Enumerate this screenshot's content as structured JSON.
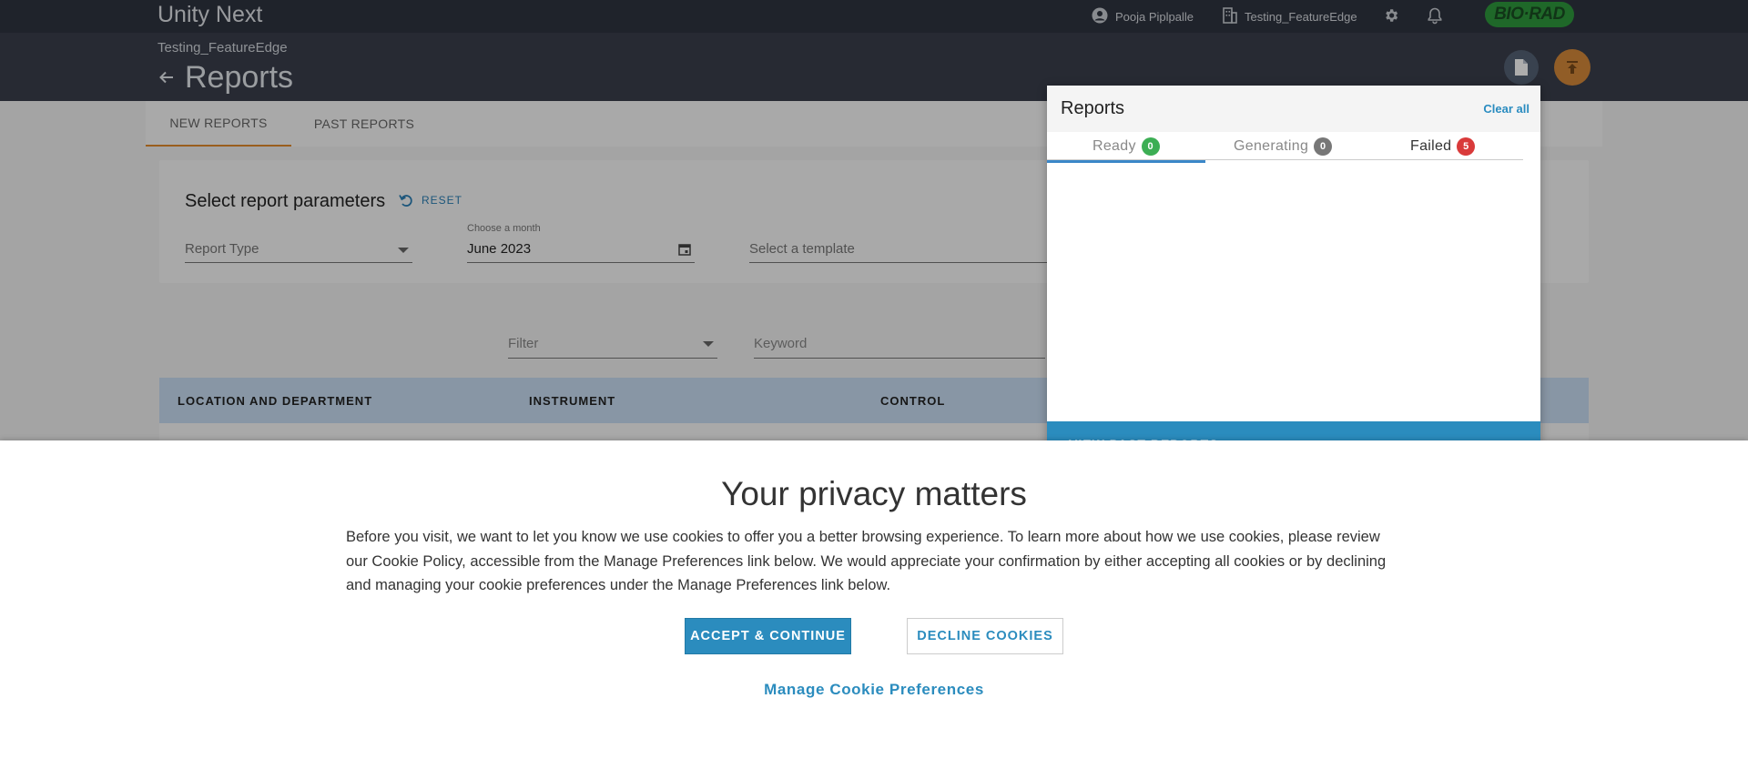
{
  "app": {
    "title": "Unity Next",
    "brand": "BIO·RAD"
  },
  "topbar": {
    "user_name": "Pooja Piplpalle",
    "lab_name": "Testing_FeatureEdge",
    "icons": [
      "user-circle-icon",
      "building-icon",
      "gear-icon",
      "bell-icon"
    ]
  },
  "header": {
    "lab_subtitle": "Testing_FeatureEdge",
    "page_title": "Reports"
  },
  "tabs": [
    {
      "label": "NEW REPORTS",
      "active": true
    },
    {
      "label": "PAST REPORTS",
      "active": false
    }
  ],
  "params": {
    "title": "Select report parameters",
    "reset_label": "RESET",
    "report_type_placeholder": "Report Type",
    "month_label": "Choose a month",
    "month_value": "June 2023",
    "template_placeholder": "Select a template"
  },
  "filters": {
    "filter_placeholder": "Filter",
    "keyword_placeholder": "Keyword"
  },
  "table": {
    "columns": [
      "LOCATION AND DEPARTMENT",
      "INSTRUMENT",
      "CONTROL"
    ]
  },
  "reports_panel": {
    "title": "Reports",
    "clear_all": "Clear all",
    "tabs": [
      {
        "label": "Ready",
        "count": "0",
        "color": "#3cae54"
      },
      {
        "label": "Generating",
        "count": "0",
        "color": "#777777"
      },
      {
        "label": "Failed",
        "count": "5",
        "color": "#d93a3a"
      }
    ],
    "view_past": "VIEW PAST REPORTS"
  },
  "privacy": {
    "title": "Your privacy matters",
    "text": "Before you visit, we want to let you know we use cookies to offer you a better browsing experience. To learn more about how we use cookies, please review our Cookie Policy, accessible from the Manage Preferences link below. We would appreciate your confirmation by either accepting all cookies or by declining and managing your cookie preferences under the Manage Preferences link below.",
    "accept_label": "ACCEPT & CONTINUE",
    "decline_label": "DECLINE COOKIES",
    "manage_label": "Manage Cookie Preferences"
  },
  "colors": {
    "accent": "#2b8cbe",
    "tab_active": "#e38b2c",
    "topbar": "#2f3440",
    "header": "#3a3f4c"
  }
}
